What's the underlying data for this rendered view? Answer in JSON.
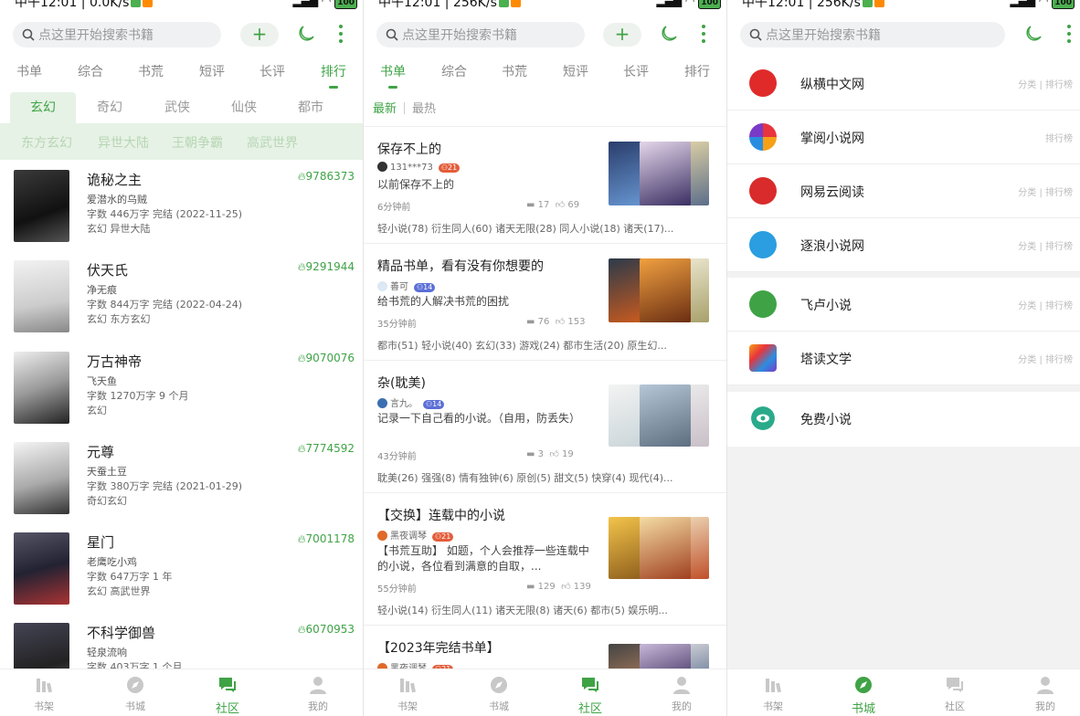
{
  "status": {
    "time_speed_left": "中午12:01 | 0.0K/s",
    "time_speed": "中午12:01 | 256K/s",
    "battery": "100"
  },
  "search": {
    "placeholder": "点这里开始搜索书籍"
  },
  "colors": {
    "accent": "#3fa346",
    "accent_bg": "#e6f2e5"
  },
  "top_tabs": [
    "书单",
    "综合",
    "书荒",
    "短评",
    "长评",
    "排行"
  ],
  "panel1": {
    "active_tab": "排行",
    "genres": [
      "玄幻",
      "奇幻",
      "武侠",
      "仙侠",
      "都市"
    ],
    "subgenres": [
      "东方玄幻",
      "异世大陆",
      "王朝争霸",
      "高武世界"
    ],
    "books": [
      {
        "title": "诡秘之主",
        "author": "爱潜水的乌贼",
        "meta": "字数 446万字  完结 (2022-11-25)",
        "tags": "玄幻 异世大陆",
        "heat": "9786373"
      },
      {
        "title": "伏天氏",
        "author": "净无痕",
        "meta": "字数 844万字  完结 (2022-04-24)",
        "tags": "玄幻 东方玄幻",
        "heat": "9291944"
      },
      {
        "title": "万古神帝",
        "author": "飞天鱼",
        "meta": "字数 1270万字  9 个月",
        "tags": "玄幻",
        "heat": "9070076"
      },
      {
        "title": "元尊",
        "author": "天蚕土豆",
        "meta": "字数 380万字  完结 (2021-01-29)",
        "tags": "奇幻玄幻",
        "heat": "7774592"
      },
      {
        "title": "星门",
        "author": "老鹰吃小鸡",
        "meta": "字数 647万字  1 年",
        "tags": "玄幻 高武世界",
        "heat": "7001178"
      },
      {
        "title": "不科学御兽",
        "author": "轻泉流响",
        "meta": "字数 403万字  1 个月",
        "tags": "",
        "heat": "6070953"
      }
    ]
  },
  "panel2": {
    "active_tab": "书单",
    "sort": {
      "newest": "最新",
      "hottest": "最热"
    },
    "lists": [
      {
        "title": "保存不上的",
        "user": "131***73",
        "level": "21",
        "desc": "以前保存不上的",
        "time": "6分钟前",
        "comments": "17",
        "likes": "69",
        "tags": "轻小说(78) 衍生同人(60) 诸天无限(28) 同人小说(18) 诸天(17)..."
      },
      {
        "title": "精品书单，看有没有你想要的",
        "user": "善可",
        "level": "14",
        "desc": "给书荒的人解决书荒的困扰",
        "time": "35分钟前",
        "comments": "76",
        "likes": "153",
        "tags": "都市(51) 轻小说(40) 玄幻(33) 游戏(24) 都市生活(20) 原生幻..."
      },
      {
        "title": "杂(耽美)",
        "user": "言九。",
        "level": "14",
        "desc": "记录一下自己看的小说。（自用，防丢失）",
        "time": "43分钟前",
        "comments": "3",
        "likes": "19",
        "tags": "耽美(26) 强强(8) 情有独钟(6) 原创(5) 甜文(5) 快穿(4) 现代(4)..."
      },
      {
        "title": "【交换】连载中的小说",
        "user": "黑夜调琴",
        "level": "21",
        "desc": "【书荒互助】 如题，个人会推荐一些连载中的小说，各位看到满意的自取，...",
        "time": "55分钟前",
        "comments": "129",
        "likes": "139",
        "tags": "轻小说(14) 衍生同人(11) 诸天无限(8) 诸天(6) 都市(5) 娱乐明..."
      },
      {
        "title": "【2023年完结书单】",
        "user": "黑夜调琴",
        "level": "21",
        "desc": "",
        "time": "",
        "comments": "",
        "likes": "",
        "tags": ""
      }
    ]
  },
  "panel3": {
    "sites": [
      {
        "name": "纵横中文网",
        "links": "分类 | 排行榜"
      },
      {
        "name": "掌阅小说网",
        "links": "排行榜"
      },
      {
        "name": "网易云阅读",
        "links": "分类 | 排行榜"
      },
      {
        "name": "逐浪小说网",
        "links": "分类 | 排行榜"
      },
      {
        "name": "飞卢小说",
        "links": "分类 | 排行榜"
      },
      {
        "name": "塔读文学",
        "links": "分类 | 排行榜"
      },
      {
        "name": "免费小说",
        "links": ""
      }
    ]
  },
  "nav": {
    "shelf": "书架",
    "city": "书城",
    "community": "社区",
    "mine": "我的"
  }
}
